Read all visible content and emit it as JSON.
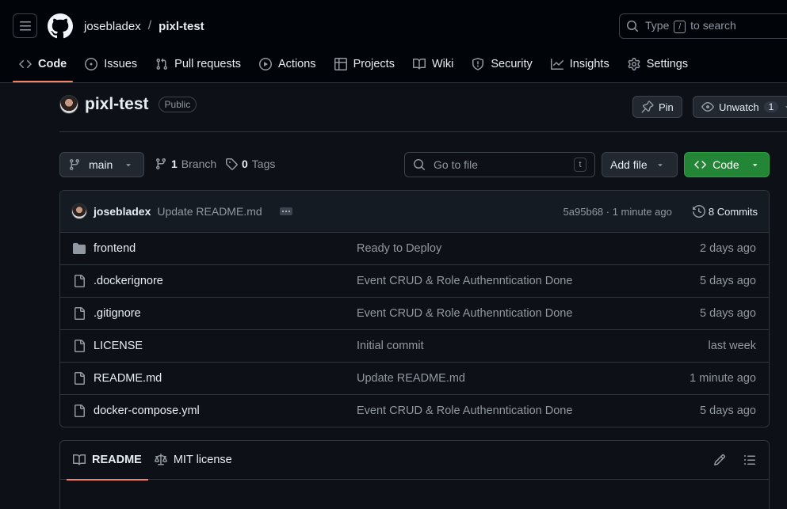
{
  "header": {
    "owner": "josebladex",
    "separator": "/",
    "repo": "pixl-test",
    "search_prefix": "Type",
    "search_key": "/",
    "search_suffix": "to search"
  },
  "tabs": [
    {
      "label": "Code",
      "icon": "code-icon"
    },
    {
      "label": "Issues",
      "icon": "issue-icon"
    },
    {
      "label": "Pull requests",
      "icon": "pull-request-icon"
    },
    {
      "label": "Actions",
      "icon": "play-icon"
    },
    {
      "label": "Projects",
      "icon": "table-icon"
    },
    {
      "label": "Wiki",
      "icon": "book-icon"
    },
    {
      "label": "Security",
      "icon": "shield-icon"
    },
    {
      "label": "Insights",
      "icon": "graph-icon"
    },
    {
      "label": "Settings",
      "icon": "gear-icon"
    }
  ],
  "repo_header": {
    "title": "pixl-test",
    "visibility": "Public",
    "pin_label": "Pin",
    "watch_label": "Unwatch",
    "watch_count": "1"
  },
  "toolbar": {
    "branch": "main",
    "branches_count": "1",
    "branches_label": "Branch",
    "tags_count": "0",
    "tags_label": "Tags",
    "goto_placeholder": "Go to file",
    "goto_key": "t",
    "add_file_label": "Add file",
    "code_label": "Code"
  },
  "latest_commit": {
    "author": "josebladex",
    "message": "Update README.md",
    "meta": "5a95b68 · 1 minute ago",
    "commits_label": "8 Commits"
  },
  "files": [
    {
      "type": "folder",
      "name": "frontend",
      "message": "Ready to Deploy",
      "age": "2 days ago"
    },
    {
      "type": "file",
      "name": ".dockerignore",
      "message": "Event CRUD & Role Authenntication Done",
      "age": "5 days ago"
    },
    {
      "type": "file",
      "name": ".gitignore",
      "message": "Event CRUD & Role Authenntication Done",
      "age": "5 days ago"
    },
    {
      "type": "file",
      "name": "LICENSE",
      "message": "Initial commit",
      "age": "last week"
    },
    {
      "type": "file",
      "name": "README.md",
      "message": "Update README.md",
      "age": "1 minute ago"
    },
    {
      "type": "file",
      "name": "docker-compose.yml",
      "message": "Event CRUD & Role Authenntication Done",
      "age": "5 days ago"
    }
  ],
  "readme": {
    "tab_readme": "README",
    "tab_license": "MIT license"
  },
  "colors": {
    "accent_tab": "#f78166",
    "code_button": "#238636"
  }
}
